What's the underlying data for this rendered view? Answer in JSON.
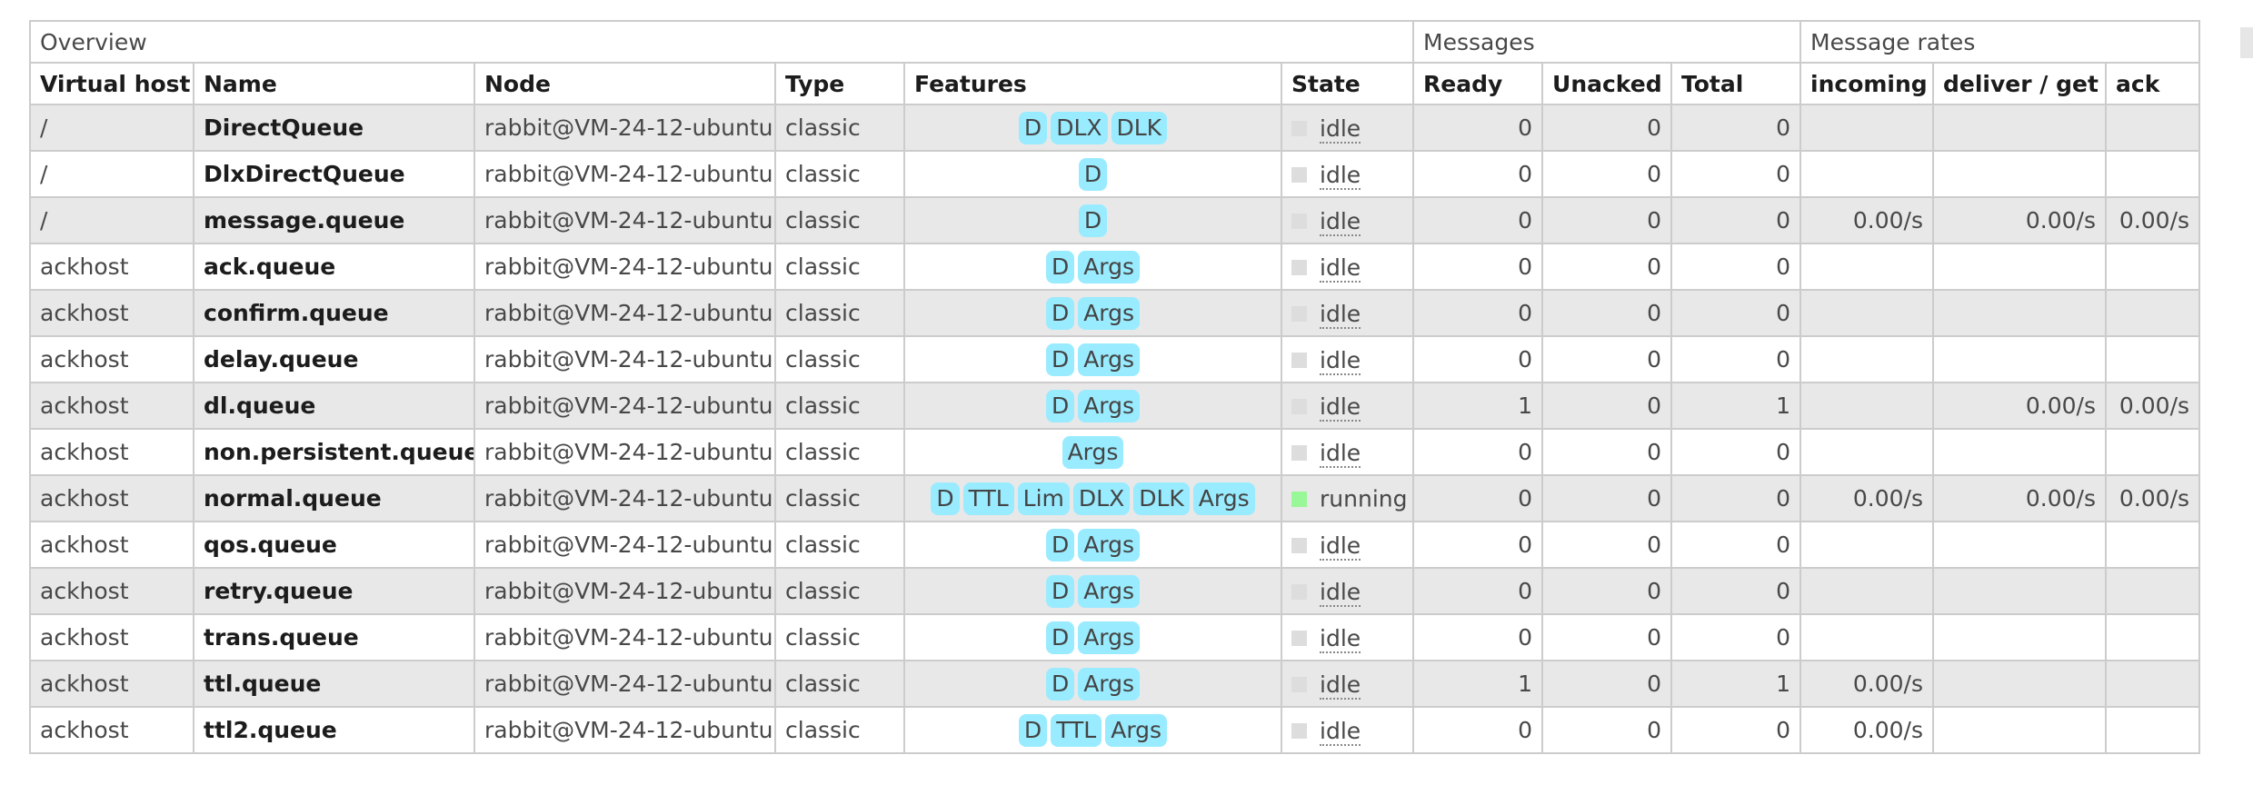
{
  "groups": {
    "overview": "Overview",
    "messages": "Messages",
    "rates": "Message rates"
  },
  "columns": {
    "vhost": "Virtual host",
    "name": "Name",
    "node": "Node",
    "type": "Type",
    "features": "Features",
    "state": "State",
    "ready": "Ready",
    "unacked": "Unacked",
    "total": "Total",
    "incoming": "incoming",
    "deliver": "deliver / get",
    "ack": "ack"
  },
  "colors": {
    "feature_tag": "#99ebff",
    "state_idle": "#dddddd",
    "state_running": "#98f898",
    "row_stripe": "#e8e8e8"
  },
  "rows": [
    {
      "vhost": "/",
      "name": "DirectQueue",
      "node": "rabbit@VM-24-12-ubuntu",
      "type": "classic",
      "features": [
        "D",
        "DLX",
        "DLK"
      ],
      "state": "idle",
      "ready": "0",
      "unacked": "0",
      "total": "0",
      "incoming": "",
      "deliver": "",
      "ack": ""
    },
    {
      "vhost": "/",
      "name": "DlxDirectQueue",
      "node": "rabbit@VM-24-12-ubuntu",
      "type": "classic",
      "features": [
        "D"
      ],
      "state": "idle",
      "ready": "0",
      "unacked": "0",
      "total": "0",
      "incoming": "",
      "deliver": "",
      "ack": ""
    },
    {
      "vhost": "/",
      "name": "message.queue",
      "node": "rabbit@VM-24-12-ubuntu",
      "type": "classic",
      "features": [
        "D"
      ],
      "state": "idle",
      "ready": "0",
      "unacked": "0",
      "total": "0",
      "incoming": "0.00/s",
      "deliver": "0.00/s",
      "ack": "0.00/s"
    },
    {
      "vhost": "ackhost",
      "name": "ack.queue",
      "node": "rabbit@VM-24-12-ubuntu",
      "type": "classic",
      "features": [
        "D",
        "Args"
      ],
      "state": "idle",
      "ready": "0",
      "unacked": "0",
      "total": "0",
      "incoming": "",
      "deliver": "",
      "ack": ""
    },
    {
      "vhost": "ackhost",
      "name": "confirm.queue",
      "node": "rabbit@VM-24-12-ubuntu",
      "type": "classic",
      "features": [
        "D",
        "Args"
      ],
      "state": "idle",
      "ready": "0",
      "unacked": "0",
      "total": "0",
      "incoming": "",
      "deliver": "",
      "ack": ""
    },
    {
      "vhost": "ackhost",
      "name": "delay.queue",
      "node": "rabbit@VM-24-12-ubuntu",
      "type": "classic",
      "features": [
        "D",
        "Args"
      ],
      "state": "idle",
      "ready": "0",
      "unacked": "0",
      "total": "0",
      "incoming": "",
      "deliver": "",
      "ack": ""
    },
    {
      "vhost": "ackhost",
      "name": "dl.queue",
      "node": "rabbit@VM-24-12-ubuntu",
      "type": "classic",
      "features": [
        "D",
        "Args"
      ],
      "state": "idle",
      "ready": "1",
      "unacked": "0",
      "total": "1",
      "incoming": "",
      "deliver": "0.00/s",
      "ack": "0.00/s"
    },
    {
      "vhost": "ackhost",
      "name": "non.persistent.queue",
      "node": "rabbit@VM-24-12-ubuntu",
      "type": "classic",
      "features": [
        "Args"
      ],
      "state": "idle",
      "ready": "0",
      "unacked": "0",
      "total": "0",
      "incoming": "",
      "deliver": "",
      "ack": ""
    },
    {
      "vhost": "ackhost",
      "name": "normal.queue",
      "node": "rabbit@VM-24-12-ubuntu",
      "type": "classic",
      "features": [
        "D",
        "TTL",
        "Lim",
        "DLX",
        "DLK",
        "Args"
      ],
      "state": "running",
      "ready": "0",
      "unacked": "0",
      "total": "0",
      "incoming": "0.00/s",
      "deliver": "0.00/s",
      "ack": "0.00/s"
    },
    {
      "vhost": "ackhost",
      "name": "qos.queue",
      "node": "rabbit@VM-24-12-ubuntu",
      "type": "classic",
      "features": [
        "D",
        "Args"
      ],
      "state": "idle",
      "ready": "0",
      "unacked": "0",
      "total": "0",
      "incoming": "",
      "deliver": "",
      "ack": ""
    },
    {
      "vhost": "ackhost",
      "name": "retry.queue",
      "node": "rabbit@VM-24-12-ubuntu",
      "type": "classic",
      "features": [
        "D",
        "Args"
      ],
      "state": "idle",
      "ready": "0",
      "unacked": "0",
      "total": "0",
      "incoming": "",
      "deliver": "",
      "ack": ""
    },
    {
      "vhost": "ackhost",
      "name": "trans.queue",
      "node": "rabbit@VM-24-12-ubuntu",
      "type": "classic",
      "features": [
        "D",
        "Args"
      ],
      "state": "idle",
      "ready": "0",
      "unacked": "0",
      "total": "0",
      "incoming": "",
      "deliver": "",
      "ack": ""
    },
    {
      "vhost": "ackhost",
      "name": "ttl.queue",
      "node": "rabbit@VM-24-12-ubuntu",
      "type": "classic",
      "features": [
        "D",
        "Args"
      ],
      "state": "idle",
      "ready": "1",
      "unacked": "0",
      "total": "1",
      "incoming": "0.00/s",
      "deliver": "",
      "ack": ""
    },
    {
      "vhost": "ackhost",
      "name": "ttl2.queue",
      "node": "rabbit@VM-24-12-ubuntu",
      "type": "classic",
      "features": [
        "D",
        "TTL",
        "Args"
      ],
      "state": "idle",
      "ready": "0",
      "unacked": "0",
      "total": "0",
      "incoming": "0.00/s",
      "deliver": "",
      "ack": ""
    }
  ]
}
